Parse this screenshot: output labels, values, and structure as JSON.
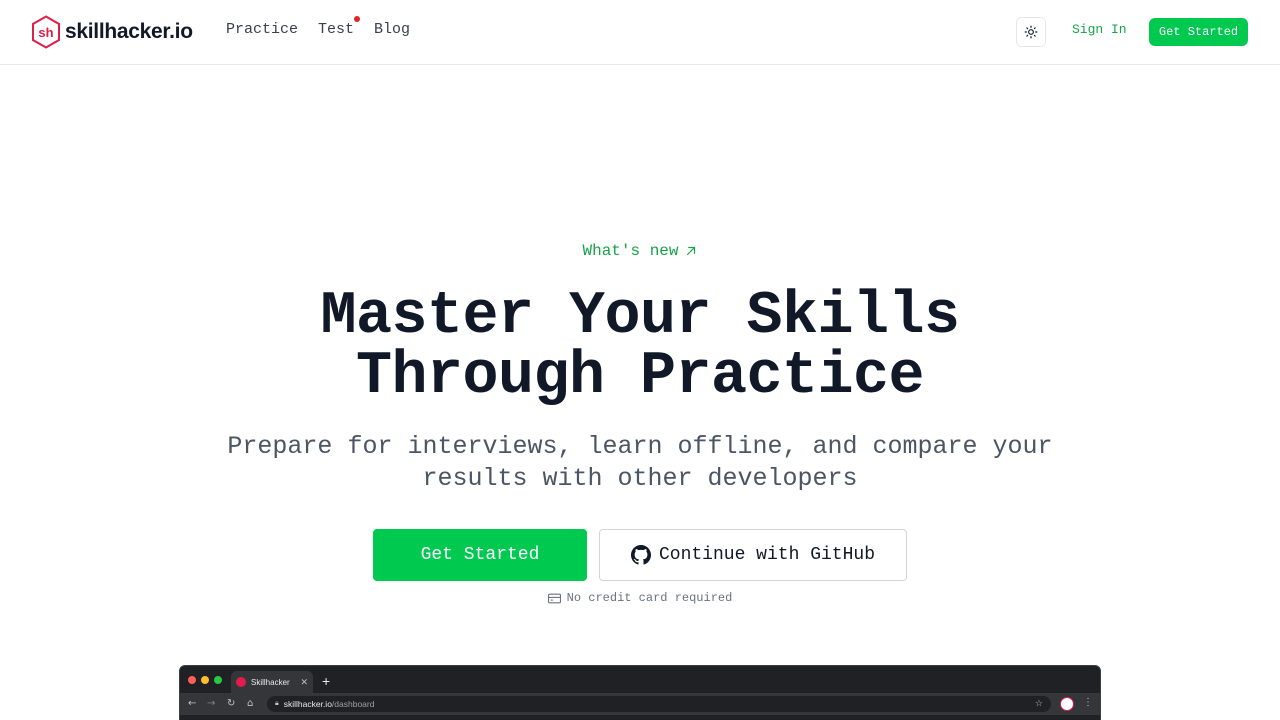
{
  "header": {
    "logo_text": "skillhacker.io",
    "nav": [
      "Practice",
      "Test",
      "Blog"
    ],
    "sign_in": "Sign In",
    "get_started": "Get Started"
  },
  "hero": {
    "whats_new": "What's new",
    "title_line1": "Master Your Skills",
    "title_line2": "Through Practice",
    "subtitle_line1": "Prepare for interviews, learn offline, and compare your",
    "subtitle_line2": "results with other developers",
    "cta_primary": "Get Started",
    "cta_github": "Continue with GitHub",
    "no_card": "No credit card required"
  },
  "browser_preview": {
    "tab_title": "Skillhacker",
    "url_host": "skillhacker.io",
    "url_path": "/dashboard"
  },
  "colors": {
    "accent": "#00c950",
    "accent_text": "#16a34a",
    "logo": "#e11d48",
    "notification": "#dc2626"
  },
  "icons": [
    "logo-mark-icon",
    "sun-icon",
    "arrow-up-right-icon",
    "github-icon",
    "credit-card-icon"
  ]
}
